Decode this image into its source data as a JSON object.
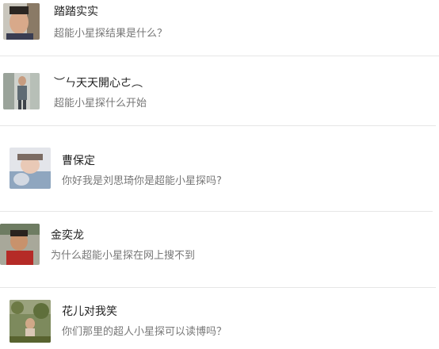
{
  "comments": [
    {
      "name": "踏踏实实",
      "message": "超能小星探结果是什么？"
    },
    {
      "name": "︶ㄣ天天開心ㄜ︵",
      "message": "超能小星探什么开始"
    },
    {
      "name": "曹保定",
      "message": "你好我是刘思琦你是超能小星探吗?"
    },
    {
      "name": "金奕龙",
      "message": "为什么超能小星探在网上搜不到"
    },
    {
      "name": "花儿对我笑",
      "message": "你们那里的超人小星探可以读博吗？"
    }
  ],
  "colors": {
    "background": "#ffffff",
    "name_text": "#222222",
    "message_text": "#777777",
    "divider": "#e6e6e6"
  }
}
